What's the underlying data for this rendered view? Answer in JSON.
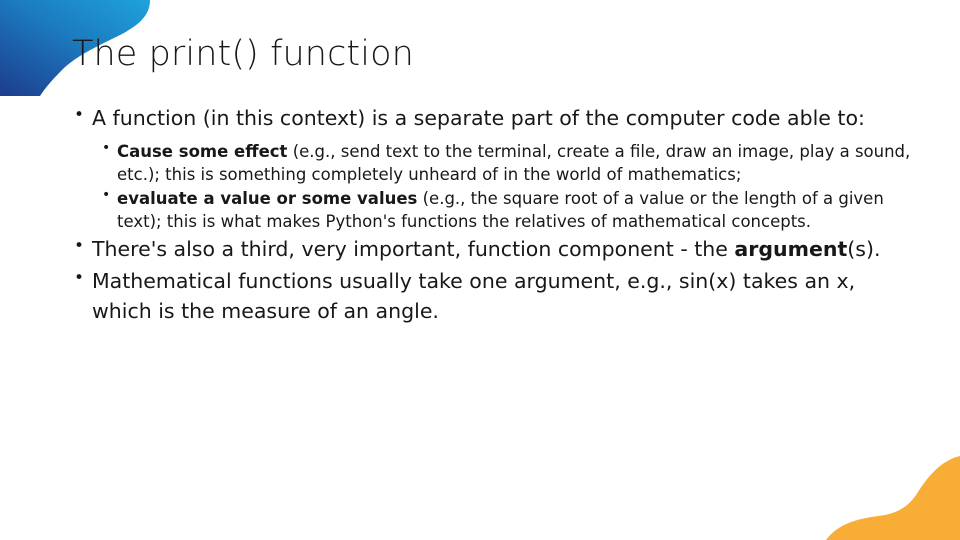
{
  "slide": {
    "title": "The print() function",
    "theme": {
      "accent_blue_light": "#1fa2dd",
      "accent_blue_dark": "#1d3f8f",
      "accent_orange": "#f8ad36",
      "text_color": "#181818",
      "background": "#ffffff"
    },
    "bullets": [
      {
        "level": 1,
        "text": "A function (in this context) is a separate part of the computer code able to:",
        "sub_bullets": [
          {
            "bold_lead": "Cause some effect",
            "rest": " (e.g., send text to the terminal, create a file, draw an image, play a sound, etc.); this is something completely unheard of in the world of mathematics;"
          },
          {
            "bold_lead": "evaluate a value or some values",
            "rest": " (e.g., the square root of a value or the length of a given text); this is what makes Python's functions the relatives of mathematical concepts."
          }
        ]
      },
      {
        "level": 1,
        "text_before_bold": "There's also a third, very important, function component - the ",
        "bold_word": "argument",
        "text_after_bold": "(s)."
      },
      {
        "level": 1,
        "text": "Mathematical functions usually take one argument, e.g., sin(x) takes an x, which is the measure of an angle."
      }
    ],
    "decorations": [
      {
        "name": "top-left-blue-blob",
        "colors": [
          "#1fa2dd",
          "#1d3f8f"
        ]
      },
      {
        "name": "bottom-right-orange-blob",
        "colors": [
          "#f8ad36"
        ]
      }
    ]
  }
}
